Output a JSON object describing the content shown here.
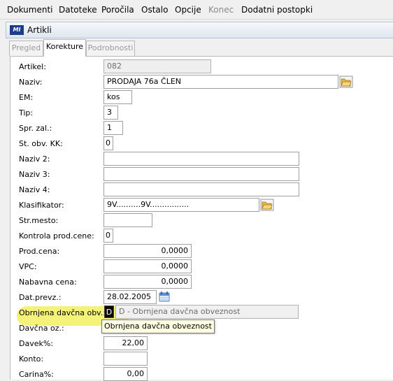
{
  "menu": [
    "Dokumenti",
    "Datoteke",
    "Poročila",
    "Ostalo",
    "Opcije",
    "Konec",
    "Dodatni postopki"
  ],
  "window": {
    "title": "Artikli",
    "icon": "app-logo-icon"
  },
  "tabs": [
    {
      "label": "Pregled",
      "underline": "P",
      "active": false
    },
    {
      "label": "Korekture",
      "underline": "K",
      "active": true
    },
    {
      "label": "Podrobnosti",
      "underline": "",
      "active": false
    }
  ],
  "form": {
    "artikel": {
      "label": "Artikel:",
      "value": "082"
    },
    "naziv": {
      "label": "Naziv:",
      "value": "PRODAJA 76a ČLEN"
    },
    "em": {
      "label": "EM:",
      "value": "kos"
    },
    "tip": {
      "label": "Tip:",
      "value": "3"
    },
    "spr_zal": {
      "label": "Spr. zal.:",
      "value": "1"
    },
    "st_obv_kk": {
      "label": "St. obv. KK:",
      "value": "0"
    },
    "naziv2": {
      "label": "Naziv 2:",
      "value": ""
    },
    "naziv3": {
      "label": "Naziv 3:",
      "value": ""
    },
    "naziv4": {
      "label": "Naziv 4:",
      "value": ""
    },
    "klasifikator": {
      "label": "Klasifikator:",
      "value": "9V..........9V................"
    },
    "str_mesto": {
      "label": "Str.mesto:",
      "value": ""
    },
    "kontrola": {
      "label": "Kontrola prod.cene:",
      "value": "0"
    },
    "prod_cena": {
      "label": "Prod.cena:",
      "value": "0,0000"
    },
    "vpc": {
      "label": "VPC:",
      "value": "0,0000"
    },
    "nabavna": {
      "label": "Nabavna cena:",
      "value": "0,0000"
    },
    "dat_prevz": {
      "label": "Dat.prevz.:",
      "value": "28.02.2005"
    },
    "obrnjena": {
      "label": "Obrnjena davčna obv.:",
      "code": "D",
      "description": "D - Obrnjena davčna obveznost"
    },
    "davcna_oz": {
      "label": "Davčna oz.:"
    },
    "davek": {
      "label": "Davek%:",
      "value": "22,00"
    },
    "konto": {
      "label": "Konto:",
      "value": ""
    },
    "carina": {
      "label": "Carina%:",
      "value": "0,00"
    }
  },
  "tooltip": "Obrnjena davčna obveznost",
  "colors": {
    "highlight": "#f4f16a",
    "title_gradient_top": "#f6f8fb"
  }
}
